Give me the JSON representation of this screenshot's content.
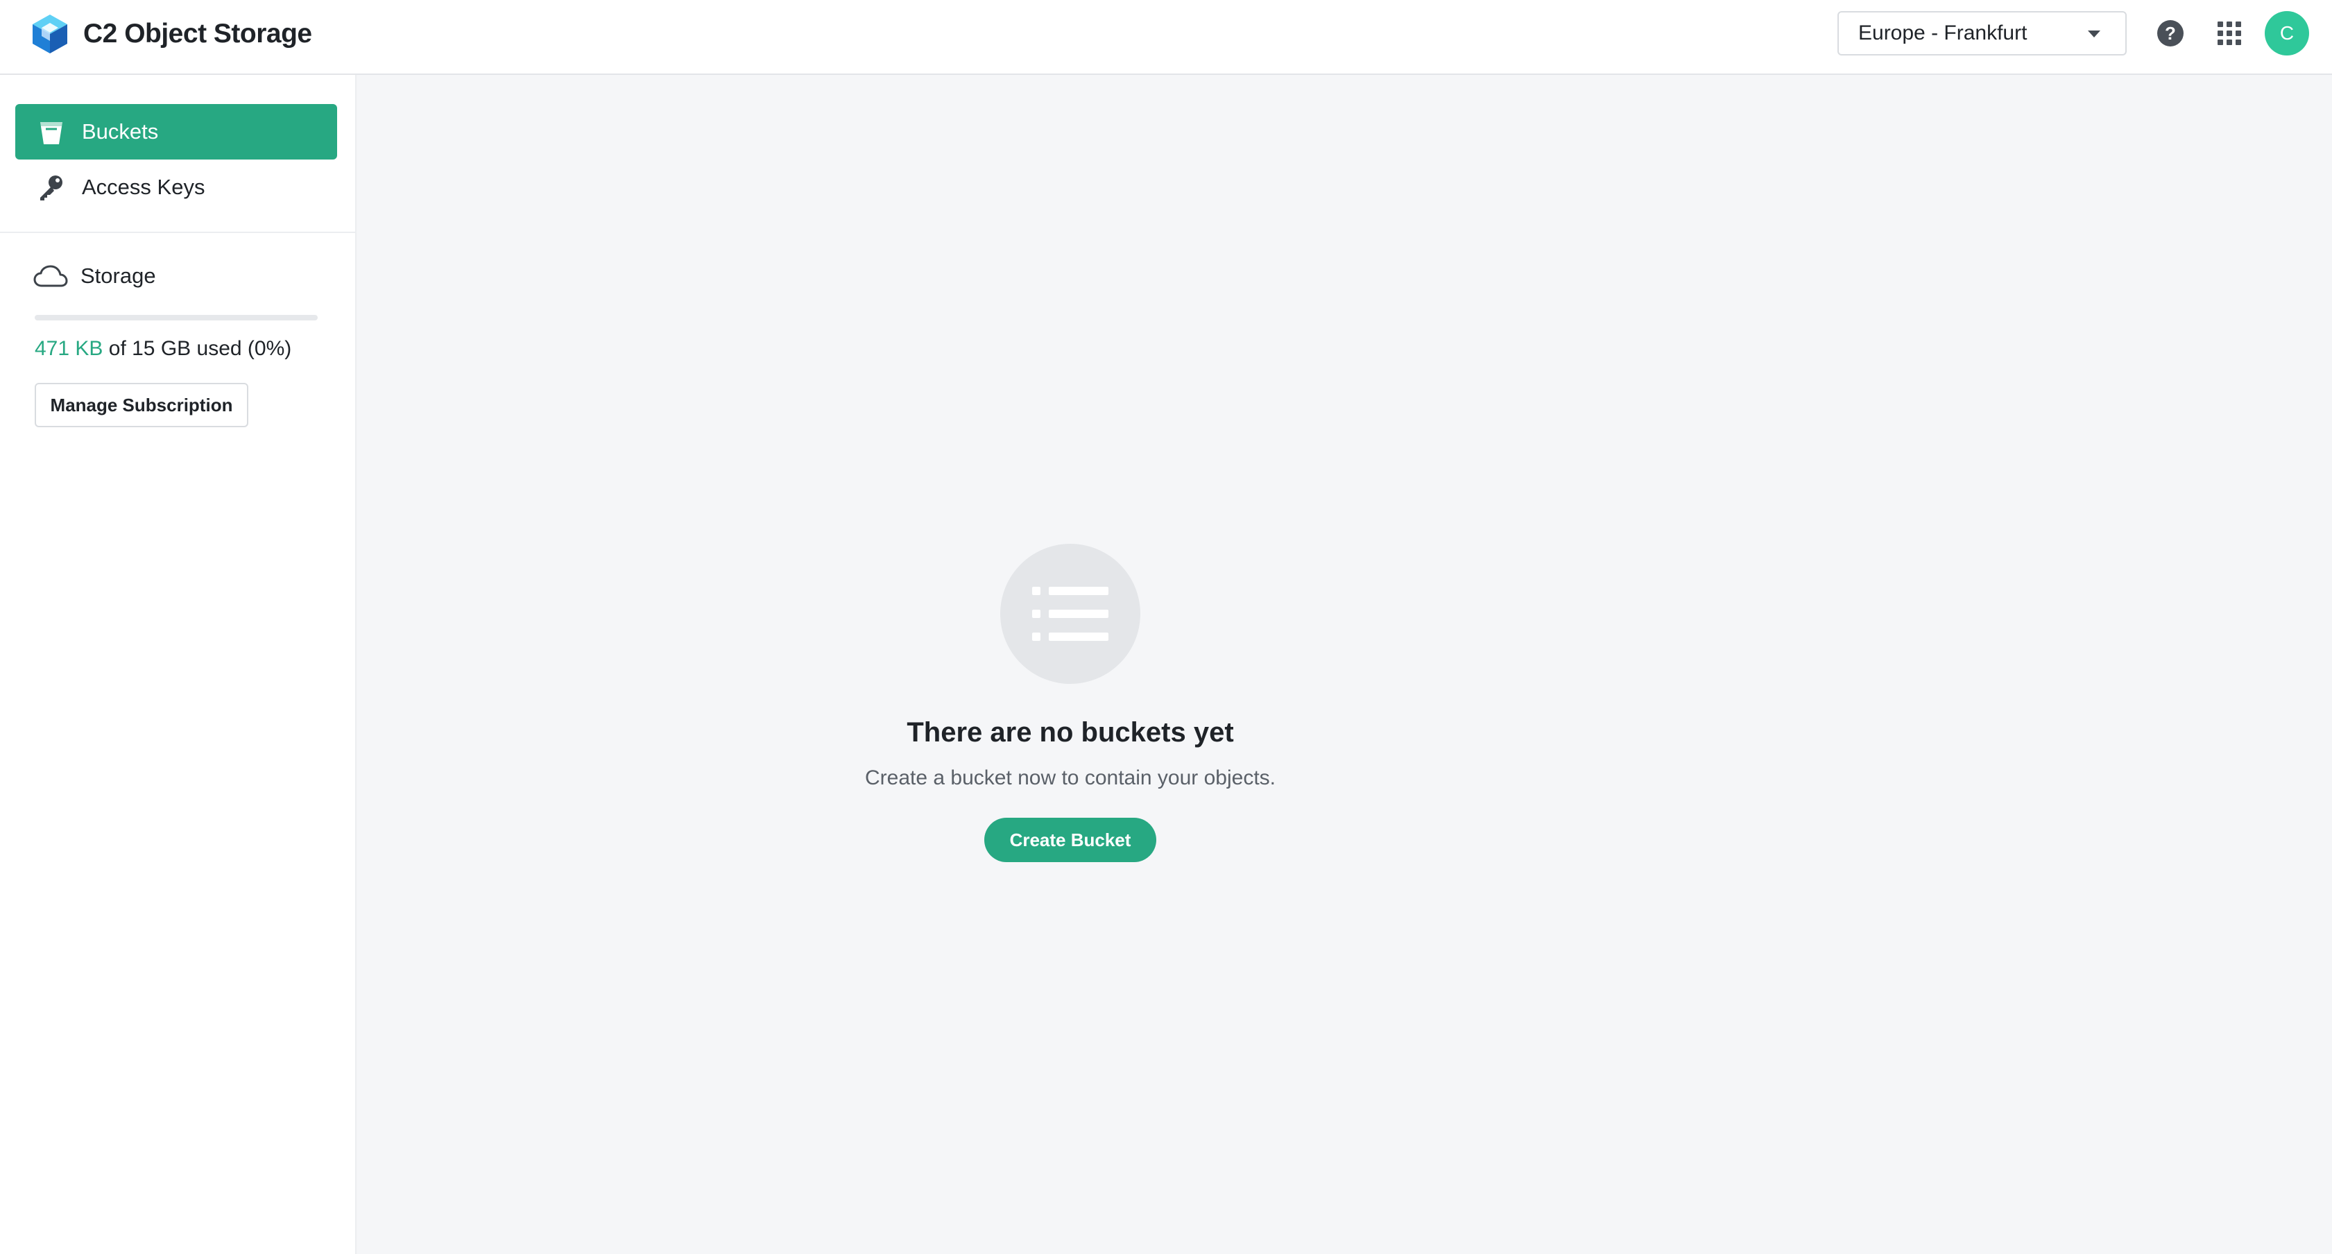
{
  "app": {
    "title": "C2 Object Storage",
    "logo_icon": "cube-logo-icon"
  },
  "header": {
    "region": {
      "selected": "Europe - Frankfurt"
    },
    "help_icon_glyph": "?",
    "avatar_initial": "C"
  },
  "sidebar": {
    "items": [
      {
        "label": "Buckets",
        "icon": "bucket-icon",
        "active": true
      },
      {
        "label": "Access Keys",
        "icon": "key-icon",
        "active": false
      }
    ],
    "storage": {
      "label": "Storage",
      "icon": "cloud-icon",
      "used": "471 KB",
      "rest": "of 15 GB used (0%)",
      "used_fraction": 0.0
    },
    "manage_label": "Manage Subscription"
  },
  "main": {
    "empty_state": {
      "icon": "list-icon",
      "title": "There are no buckets yet",
      "subtitle": "Create a bucket now to contain your objects.",
      "button_label": "Create Bucket"
    }
  },
  "colors": {
    "accent": "#27a882",
    "avatar": "#2fc89a",
    "page_background": "#f5f6f8"
  }
}
